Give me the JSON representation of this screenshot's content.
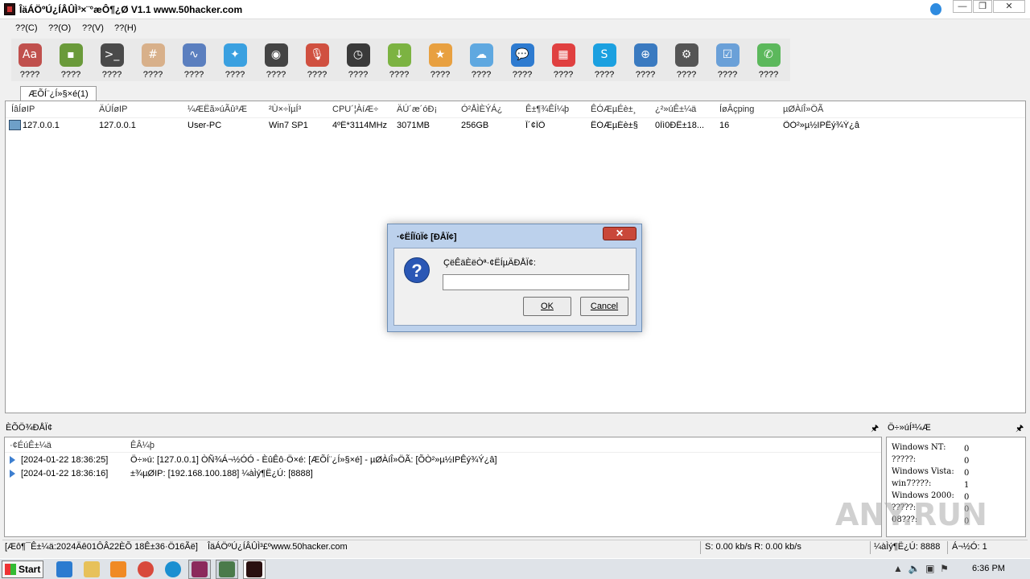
{
  "window": {
    "title": "ÎäÁÖºÚ¿ÍÂÛÌ³×¨°æÔ¶¿Ø V1.1 www.50hacker.com",
    "controls": [
      "—",
      "❐",
      "✕"
    ]
  },
  "menu": [
    "??(C)",
    "??(O)",
    "??(V)",
    "??(H)"
  ],
  "toolbar": [
    {
      "label": "????",
      "icon": "font-icon",
      "glyph": "Aa",
      "color": "#c0504d"
    },
    {
      "label": "????",
      "icon": "hard-drive-icon",
      "glyph": "▪",
      "color": "#6a9a3a"
    },
    {
      "label": "????",
      "icon": "terminal-icon",
      "glyph": ">_",
      "color": "#4a4a4a"
    },
    {
      "label": "????",
      "icon": "calculator-icon",
      "glyph": "#",
      "color": "#d8b08a"
    },
    {
      "label": "????",
      "icon": "activity-monitor-icon",
      "glyph": "∿",
      "color": "#5b7fbf"
    },
    {
      "label": "????",
      "icon": "app-store-icon",
      "glyph": "✦",
      "color": "#3aa0e0"
    },
    {
      "label": "????",
      "icon": "webcam-icon",
      "glyph": "◉",
      "color": "#444444"
    },
    {
      "label": "????",
      "icon": "microphone-icon",
      "glyph": "🎙",
      "color": "#d05040"
    },
    {
      "label": "????",
      "icon": "clock-icon",
      "glyph": "◷",
      "color": "#3a3a3a"
    },
    {
      "label": "????",
      "icon": "download-icon",
      "glyph": "↓",
      "color": "#7cb342"
    },
    {
      "label": "????",
      "icon": "star-icon",
      "glyph": "★",
      "color": "#e8a040"
    },
    {
      "label": "????",
      "icon": "cloud-icon",
      "glyph": "☁",
      "color": "#5fa8e0"
    },
    {
      "label": "????",
      "icon": "chat-bubble-icon",
      "glyph": "💬",
      "color": "#2e7bd0"
    },
    {
      "label": "????",
      "icon": "calendar-icon",
      "glyph": "▦",
      "color": "#e04040"
    },
    {
      "label": "????",
      "icon": "skype-icon",
      "glyph": "S",
      "color": "#1ba0e0"
    },
    {
      "label": "????",
      "icon": "globe-icon",
      "glyph": "⊕",
      "color": "#3a7ac0"
    },
    {
      "label": "????",
      "icon": "settings-gear-icon",
      "glyph": "⚙",
      "color": "#555555"
    },
    {
      "label": "????",
      "icon": "checklist-icon",
      "glyph": "☑",
      "color": "#6aa0d8"
    },
    {
      "label": "????",
      "icon": "phone-icon",
      "glyph": "✆",
      "color": "#5cb85c"
    }
  ],
  "tab": {
    "label": "ÆÕÍ¨¿Í»§×é(1)"
  },
  "hosts": {
    "columns": [
      "ÍâÍøIP",
      "ÄÚÍøIP",
      "¼ÆËã»úÃû³Æ",
      "²Ù×÷ÏµÍ³",
      "CPU´¦ÀíÆ÷",
      "ÄÚ´æ´óÐ¡",
      "Ó²ÅÌÈÝÁ¿",
      "Ê±¶¾ÊÍ¼þ",
      "ÊÓÆµÉè±¸",
      "¿²»úÊ±¼ä",
      "ÍøÂçping",
      "µØÀíÎ»ÖÃ"
    ],
    "rows": [
      [
        "127.0.0.1",
        "127.0.0.1",
        "User-PC",
        "Win7 SP1",
        "4ºË*3114MHz",
        "3071MB",
        "256GB",
        "Î´¢ÏÖ",
        "ÊÓÆµÉè±§",
        "0Ìì0ÐÊ±18...",
        "16",
        "ÕÒ²»µ½IPÊý¾Ý¿â"
      ]
    ]
  },
  "dialog": {
    "title": "·¢ËÍÏûÏ¢ [ÐÅÏ¢]",
    "prompt": "ÇëÊäÈëÒª·¢ËÍµÄÐÅÏ¢:",
    "input_value": "",
    "ok_label": "OK",
    "cancel_label": "Cancel",
    "close_glyph": "✕"
  },
  "log": {
    "pane_title": "ÈÕÖ¾ÐÅÏ¢",
    "columns": [
      "·¢ÉúÊ±¼ä",
      "ÊÂ¼þ"
    ],
    "rows": [
      {
        "time": "[2024-01-22 18:36:25]",
        "event": "Ö÷»ú: [127.0.0.1] ÒÑ¾­Á¬½ÓÓ - ÈûÊô·Ö×é: [ÆÕÍ¨¿Í»§×é] - µØÀíÎ»ÖÃ: [ÕÒ²»µ½IPÊý¾Ý¿â]"
      },
      {
        "time": "[2024-01-22 18:36:16]",
        "event": "±¾µØIP: [192.168.100.188] ¼àÌý¶Ë¿Ú: [8888]"
      }
    ]
  },
  "stats": {
    "pane_title": "Ö÷»úÍ³¼Æ",
    "rows": [
      {
        "label": "Windows NT:",
        "value": "0"
      },
      {
        "label": "?????:",
        "value": "0"
      },
      {
        "label": "Windows Vista:",
        "value": "0"
      },
      {
        "label": "win7????:",
        "value": "1"
      },
      {
        "label": "Windows 2000:",
        "value": "0"
      },
      {
        "label": "?????:",
        "value": "0"
      },
      {
        "label": "08???:",
        "value": "0"
      }
    ]
  },
  "watermark": "ANY.RUN",
  "statusbar": {
    "startup": "[Æô¶¯Ê±¼ä:2024Äê01ÔÂ22ÈÕ 18Ê±36·Ö16Ãë]",
    "site": "ÎäÁÖºÚ¿ÍÂÛÌ³£ºwww.50hacker.com",
    "speed": "S: 0.00 kb/s R: 0.00 kb/s",
    "port": "¼àÌý¶Ë¿Ú: 8888",
    "online": "Á¬½Ó: 1"
  },
  "taskbar": {
    "start_label": "Start",
    "clock": "6:36 PM"
  }
}
